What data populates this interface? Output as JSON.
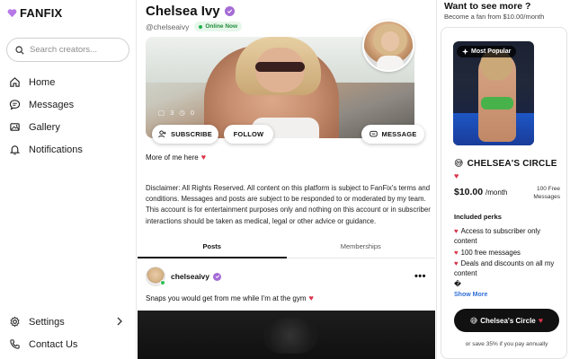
{
  "app": {
    "logo": "FANFIX"
  },
  "search": {
    "placeholder": "Search creators..."
  },
  "nav": {
    "home": "Home",
    "messages": "Messages",
    "gallery": "Gallery",
    "notifications": "Notifications",
    "settings": "Settings",
    "contact": "Contact Us"
  },
  "profile": {
    "name": "Chelsea Ivy",
    "handle": "@chelseaivy",
    "status": "Online Now",
    "stats": {
      "photos": "3",
      "videos": "0"
    },
    "bio": "More of me here",
    "disclaimer": "Disclaimer: All Rights Reserved. All content on this platform is subject to FanFix's terms and conditions. Messages and posts are subject to be responded to or moderated by my team. This account is for entertainment purposes only and nothing on this account or in subscriber interactions should be taken as medical, legal or other advice or guidance.",
    "buttons": {
      "subscribe": "SUBSCRIBE",
      "follow": "FOLLOW",
      "message": "MESSAGE"
    }
  },
  "tabs": {
    "posts": "Posts",
    "memberships": "Memberships"
  },
  "post": {
    "user": "chelseaivy",
    "caption": "Snaps you would get from me while I'm at the gym",
    "more": "•••"
  },
  "right": {
    "title": "Want to see more ?",
    "subtitle": "Become a fan from $10.00/month",
    "badge": "Most Popular",
    "tier_name": "CHELSEA'S CIRCLE",
    "tier_emoji": "😅",
    "price": "$10.00",
    "price_unit": "/month",
    "free_messages_line1": "100 Free",
    "free_messages_line2": "Messages",
    "perks_title": "Included perks",
    "perks": [
      "Access to subscriber only content",
      "100 free messages",
      "Deals and discounts on all my content",
      "�"
    ],
    "show_more": "Show More",
    "cta": "Chelsea's Circle",
    "annual": "or save 35% if you pay annually"
  },
  "colors": {
    "accent": "#a46bd6",
    "online": "#22b04a",
    "heart": "#d9344a",
    "link": "#2f6fd6"
  }
}
